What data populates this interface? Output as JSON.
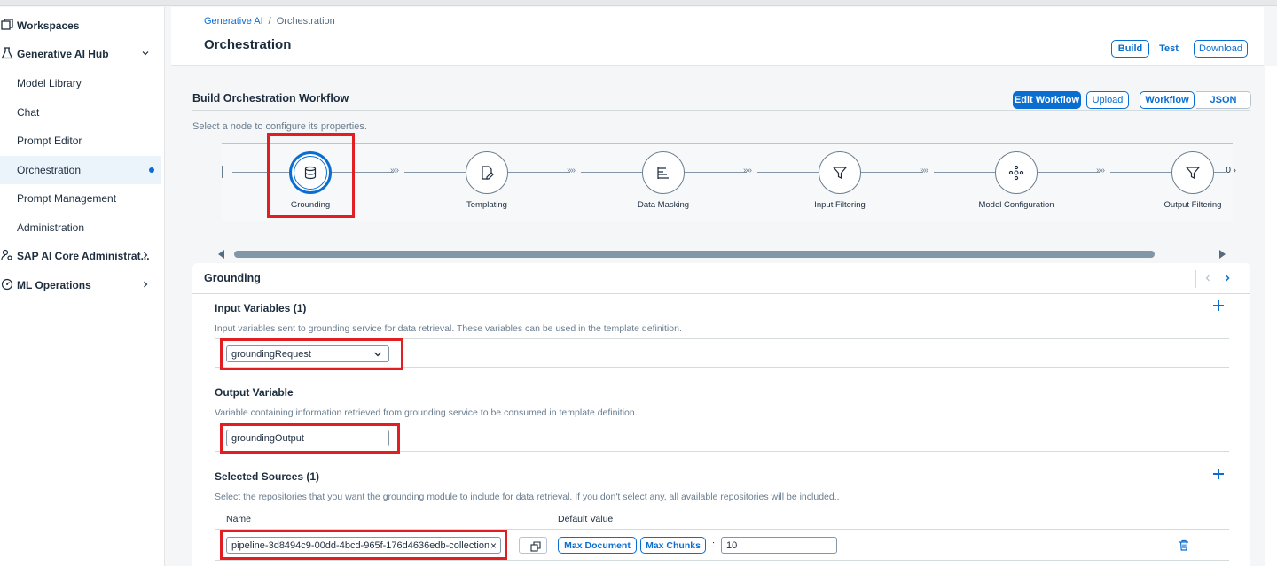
{
  "sidebar": {
    "items": [
      {
        "label": "Workspaces",
        "icon": "workspaces-icon"
      },
      {
        "label": "Generative AI Hub",
        "icon": "flask-icon"
      },
      {
        "label": "Model Library"
      },
      {
        "label": "Chat"
      },
      {
        "label": "Prompt Editor"
      },
      {
        "label": "Orchestration"
      },
      {
        "label": "Prompt Management"
      },
      {
        "label": "Administration"
      },
      {
        "label": "SAP AI Core Administrat...",
        "icon": "people-settings-icon"
      },
      {
        "label": "ML Operations",
        "icon": "gauge-icon"
      }
    ]
  },
  "header": {
    "breadcrumb": {
      "parent": "Generative AI",
      "separator": "/",
      "current": "Orchestration"
    },
    "title": "Orchestration",
    "tabs": {
      "build": "Build",
      "test": "Test",
      "download": "Download"
    }
  },
  "workflow": {
    "title": "Build Orchestration Workflow",
    "hint": "Select a node to configure its properties.",
    "edit_label": "Edit Workflow",
    "upload_label": "Upload",
    "view_workflow": "Workflow",
    "view_json": "JSON",
    "arrows": "»»",
    "more": "0 ›",
    "nodes": [
      {
        "label": "Grounding",
        "icon": "database-icon"
      },
      {
        "label": "Templating",
        "icon": "edit-document-icon"
      },
      {
        "label": "Data Masking",
        "icon": "list-bars-icon"
      },
      {
        "label": "Input Filtering",
        "icon": "filter-icon"
      },
      {
        "label": "Model Configuration",
        "icon": "network-icon"
      },
      {
        "label": "Output Filtering",
        "icon": "filter-icon"
      }
    ]
  },
  "grounding": {
    "title": "Grounding",
    "input": {
      "title": "Input Variables (1)",
      "desc": "Input variables sent to grounding service for data retrieval. These variables can be used in the template definition.",
      "value": "groundingRequest"
    },
    "output": {
      "title": "Output Variable",
      "desc": "Variable containing information retrieved from grounding service to be consumed in template definition.",
      "value": "groundingOutput"
    },
    "sources": {
      "title": "Selected Sources (1)",
      "desc": "Select the repositories that you want the grounding module to include for data retrieval. If you don't select any, all available repositories will be included..",
      "col_name": "Name",
      "col_default": "Default Value",
      "source_value": "pipeline-3d8494c9-00dd-4bcd-965f-176d4636edb-collection",
      "clear": "×",
      "max_document": "Max Document",
      "max_chunks": "Max Chunks",
      "colon": ":",
      "chunks_value": "10"
    }
  },
  "colors": {
    "accent": "#0a6ed1",
    "highlight": "#e11e22",
    "text": "#1d2d3e"
  }
}
